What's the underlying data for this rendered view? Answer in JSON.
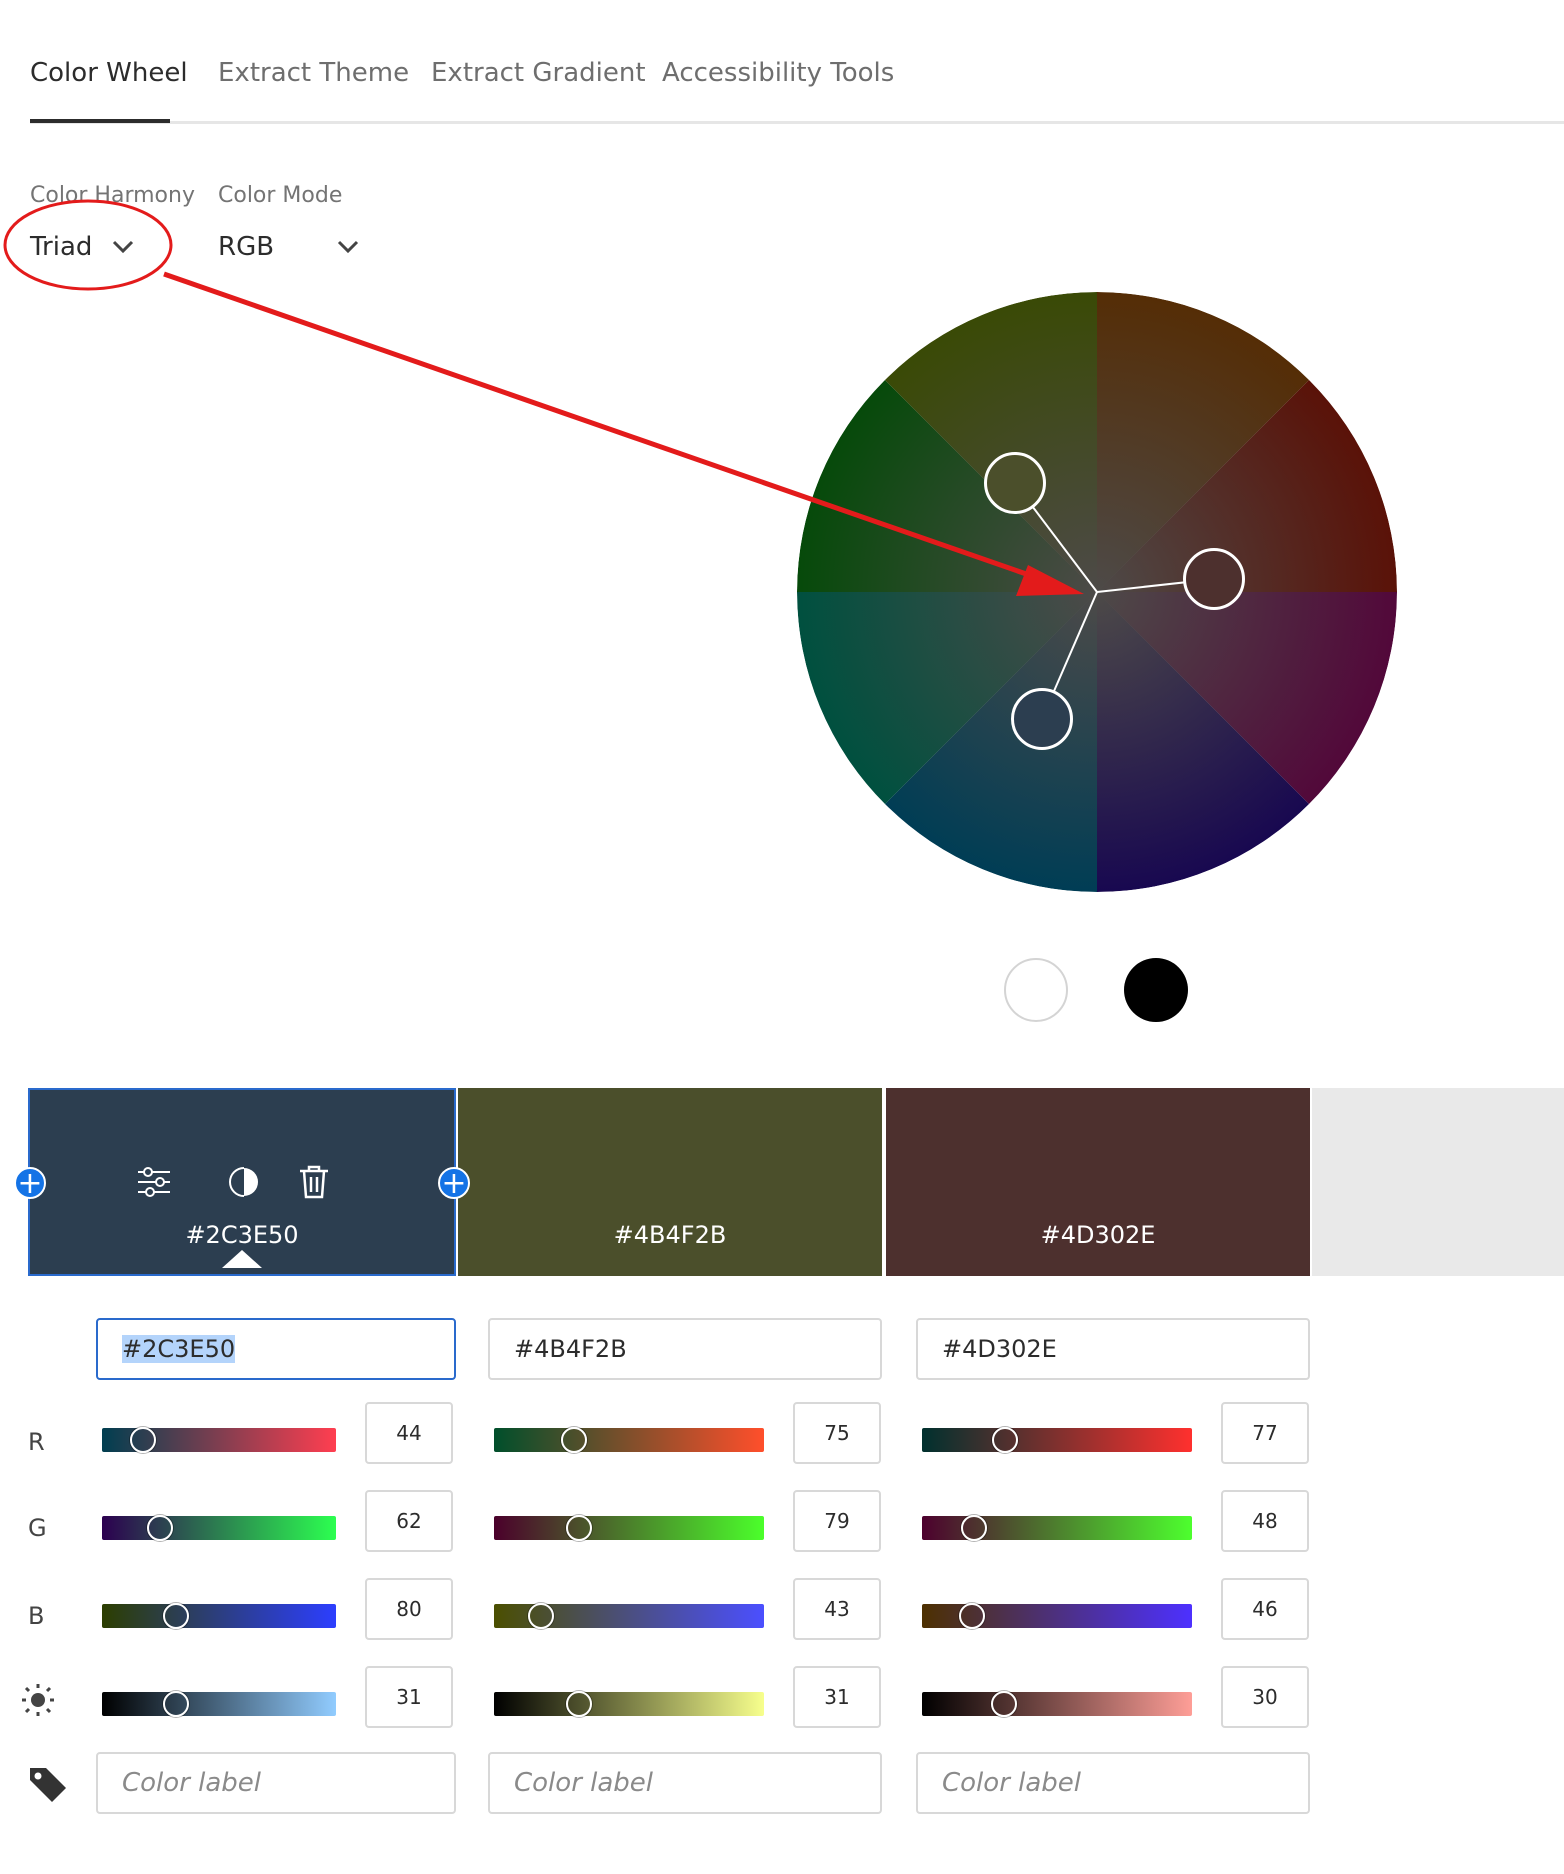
{
  "tabs": [
    {
      "label": "Color Wheel",
      "active": true
    },
    {
      "label": "Extract Theme",
      "active": false
    },
    {
      "label": "Extract Gradient",
      "active": false
    },
    {
      "label": "Accessibility Tools",
      "active": false
    }
  ],
  "harmony": {
    "label": "Color Harmony",
    "value": "Triad"
  },
  "mode": {
    "label": "Color Mode",
    "value": "RGB"
  },
  "swatches": [
    {
      "hex": "#2C3E50",
      "selected": true,
      "r": 44,
      "g": 62,
      "b": 80,
      "brightness": 31,
      "label_placeholder": "Color label"
    },
    {
      "hex": "#4B4F2B",
      "selected": false,
      "r": 75,
      "g": 79,
      "b": 43,
      "brightness": 31,
      "label_placeholder": "Color label"
    },
    {
      "hex": "#4D302E",
      "selected": false,
      "r": 77,
      "g": 48,
      "b": 46,
      "brightness": 30,
      "label_placeholder": "Color label"
    }
  ],
  "row_labels": {
    "r": "R",
    "g": "G",
    "b": "B"
  },
  "icons": {
    "adjust": "sliders-icon",
    "contrast": "contrast-icon",
    "delete": "trash-icon",
    "add": "plus-icon",
    "brightness": "sun-icon",
    "label": "tag-icon",
    "chevron": "chevron-down-icon"
  },
  "colors": {
    "accent": "#1473e6",
    "annotation": "#e31b1b",
    "focus": "#2a6acc"
  }
}
